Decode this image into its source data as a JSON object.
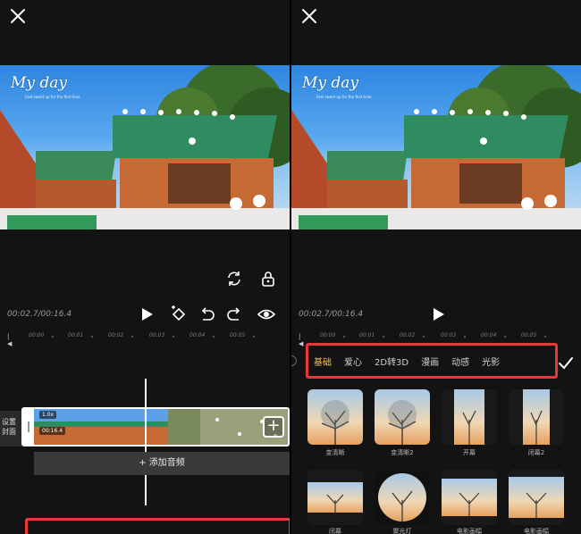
{
  "left": {
    "preview": {
      "title": "My day",
      "subtitle": "Feel sweet up for the first time"
    },
    "time": "00:02.7/00:16.4",
    "ruler": [
      "00:00",
      "00:01",
      "00:02",
      "00:03",
      "00:04",
      "00:05"
    ],
    "cover_label": "设置封面",
    "clip_badge": "1.0x",
    "clip_time": "00:16.4",
    "add_audio": "+ 添加音频",
    "icons": [
      "close-icon",
      "rotate-icon",
      "lock-icon",
      "play-icon",
      "keyframe-icon",
      "undo-icon",
      "redo-icon",
      "eye-icon"
    ]
  },
  "right": {
    "preview": {
      "title": "My day",
      "subtitle": "Feel sweet up for the first time"
    },
    "time": "00:02.7/00:16.4",
    "ruler": [
      "00:00",
      "00:01",
      "00:02",
      "00:03",
      "00:04",
      "00:05"
    ],
    "filter_tabs": [
      "基础",
      "爱心",
      "2D转3D",
      "漫画",
      "动感",
      "光影"
    ],
    "active_tab": 0,
    "effects": [
      "变清晰",
      "变清晰2",
      "开幕",
      "闭幕2",
      "闭幕",
      "聚光灯",
      "电影画幅",
      "电影画幅"
    ],
    "colors": {
      "accent": "#f3c04a",
      "highlight": "#e63a3a"
    }
  }
}
